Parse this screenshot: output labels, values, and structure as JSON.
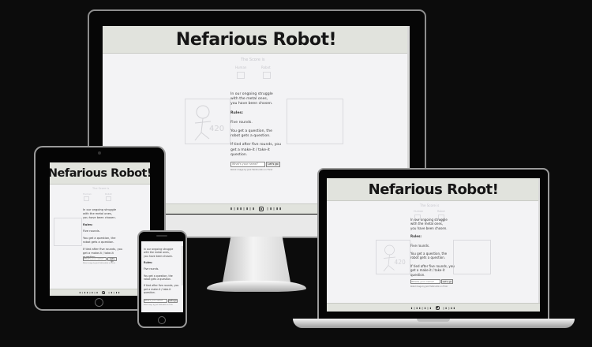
{
  "site": {
    "title": "Nefarious Robot!",
    "score_label": "The Score is",
    "human_label": "Human",
    "robot_label": "Robot",
    "intro": "In our ongoing struggle with the metal ones, you have been chosen.",
    "intro_l1": "In our ongoing struggle",
    "intro_l2": "with the metal ones,",
    "intro_l3": "you have been chosen.",
    "rules_heading": "Rules:",
    "rule1": "Five rounds.",
    "rule2_l1": "You get a question, the",
    "rule2_l2": "robot gets a question.",
    "rule3_l1": "If tied after five rounds, you",
    "rule3_l2": "get a make-it / take-it",
    "rule3_l3": "question.",
    "input_placeholder": "What's your name?",
    "button_label": "Let's go",
    "credit": "Robot image by Jack Fakhruddin on Flickr",
    "footer_brand": "▮▯▮▮▯▮▯▮",
    "footer_brand2": "▯▮▯▮▮"
  },
  "devices": [
    "desktop-monitor",
    "tablet",
    "phone",
    "laptop"
  ]
}
